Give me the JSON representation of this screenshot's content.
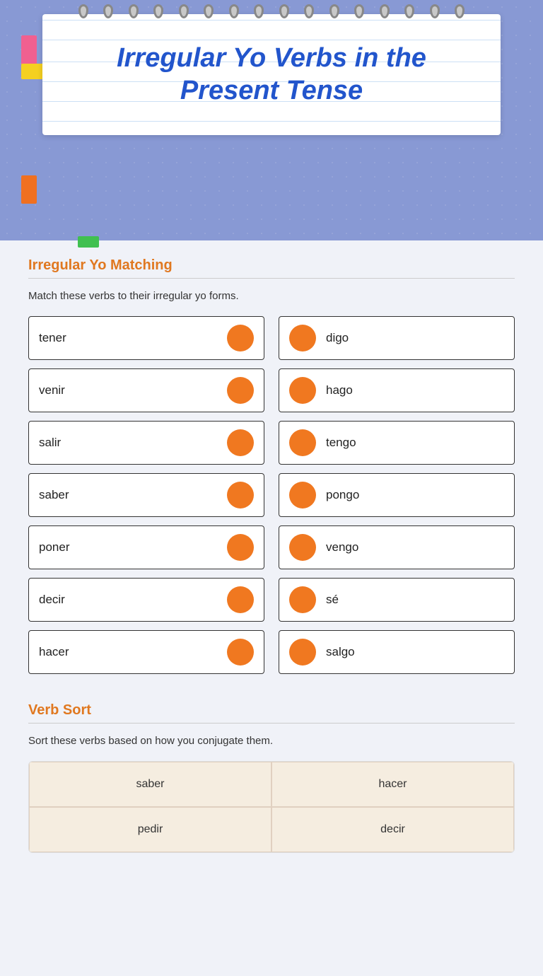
{
  "header": {
    "title_line1": "Irregular Yo Verbs in the",
    "title_line2": "Present Tense"
  },
  "matching_section": {
    "title": "Irregular Yo Matching",
    "instruction": "Match these verbs to their irregular yo forms.",
    "pairs": [
      {
        "left": "tener",
        "right": "digo"
      },
      {
        "left": "venir",
        "right": "hago"
      },
      {
        "left": "salir",
        "right": "tengo"
      },
      {
        "left": "saber",
        "right": "pongo"
      },
      {
        "left": "poner",
        "right": "vengo"
      },
      {
        "left": "decir",
        "right": "sé"
      },
      {
        "left": "hacer",
        "right": "salgo"
      }
    ]
  },
  "verb_sort_section": {
    "title": "Verb Sort",
    "instruction": "Sort these verbs based on how you conjugate them.",
    "cells": [
      {
        "text": "saber"
      },
      {
        "text": "hacer"
      },
      {
        "text": "pedir"
      },
      {
        "text": "decir"
      }
    ]
  }
}
